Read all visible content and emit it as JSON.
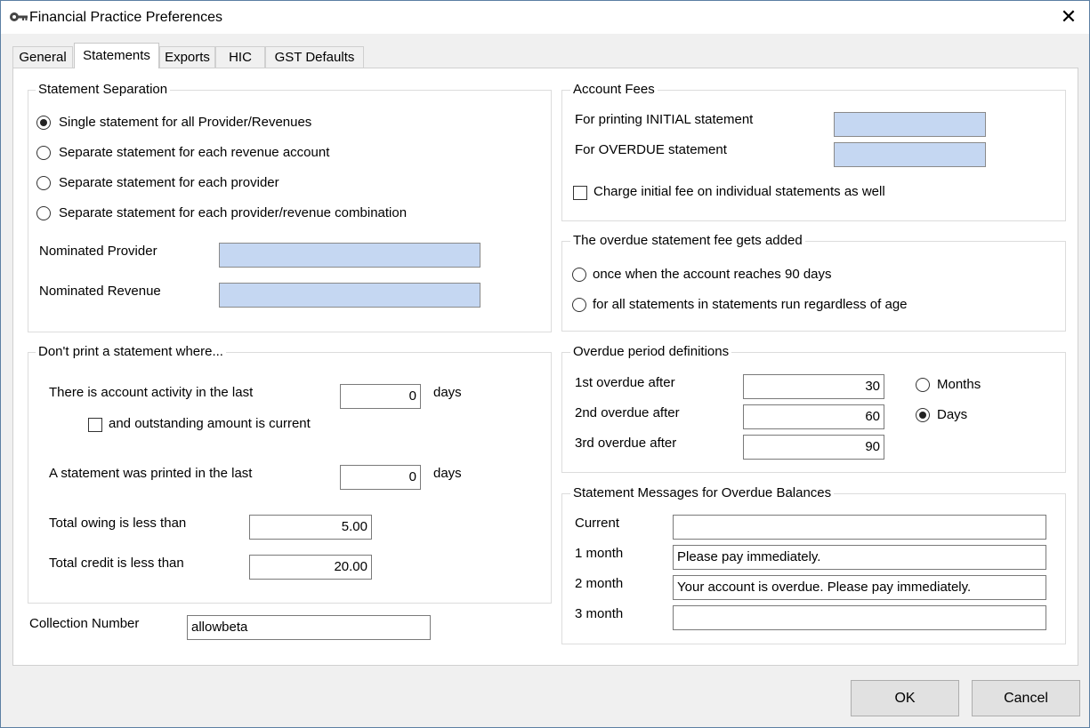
{
  "window": {
    "title": "Financial Practice Preferences",
    "close_glyph": "✕",
    "app_icon": "key-icon"
  },
  "tabs": [
    {
      "label": "General",
      "active": false
    },
    {
      "label": "Statements",
      "active": true
    },
    {
      "label": "Exports",
      "active": false
    },
    {
      "label": "HIC",
      "active": false
    },
    {
      "label": "GST Defaults",
      "active": false
    }
  ],
  "statement_separation": {
    "legend": "Statement Separation",
    "options": [
      {
        "label": "Single statement for all Provider/Revenues",
        "selected": true
      },
      {
        "label": "Separate statement for each revenue account",
        "selected": false
      },
      {
        "label": "Separate statement for each provider",
        "selected": false
      },
      {
        "label": "Separate statement for each provider/revenue combination",
        "selected": false
      }
    ],
    "nominated_provider_label": "Nominated Provider",
    "nominated_provider_value": "",
    "nominated_revenue_label": "Nominated Revenue",
    "nominated_revenue_value": ""
  },
  "dont_print": {
    "legend": "Don't print a statement where...",
    "activity_label": "There is account activity in the last",
    "activity_value": "0",
    "activity_unit": "days",
    "outstanding_label": "and outstanding amount is current",
    "outstanding_checked": false,
    "printed_label": "A statement was printed in the last",
    "printed_value": "0",
    "printed_unit": "days",
    "owing_label": "Total owing is less than",
    "owing_value": "5.00",
    "credit_label": "Total credit is less than",
    "credit_value": "20.00"
  },
  "collection": {
    "label": "Collection Number",
    "value": "allowbeta"
  },
  "account_fees": {
    "legend": "Account Fees",
    "initial_label": "For printing INITIAL statement",
    "initial_value": "",
    "overdue_label": "For OVERDUE statement",
    "overdue_value": "",
    "charge_label": "Charge initial fee on individual statements as well",
    "charge_checked": false
  },
  "overdue_fee": {
    "legend": "The overdue statement fee gets added",
    "options": [
      {
        "label": "once when the account reaches 90 days",
        "selected": false
      },
      {
        "label": "for all statements in statements run regardless of age",
        "selected": false
      }
    ]
  },
  "overdue_period": {
    "legend": "Overdue period definitions",
    "rows": [
      {
        "label": "1st overdue after",
        "value": "30"
      },
      {
        "label": "2nd overdue after",
        "value": "60"
      },
      {
        "label": "3rd overdue after",
        "value": "90"
      }
    ],
    "units": [
      {
        "label": "Months",
        "selected": false
      },
      {
        "label": "Days",
        "selected": true
      }
    ]
  },
  "messages": {
    "legend": "Statement Messages for Overdue Balances",
    "rows": [
      {
        "label": "Current",
        "value": ""
      },
      {
        "label": "1 month",
        "value": "Please pay immediately."
      },
      {
        "label": "2 month",
        "value": "Your account is overdue. Please pay immediately."
      },
      {
        "label": "3 month",
        "value": ""
      }
    ]
  },
  "buttons": {
    "ok": "OK",
    "cancel": "Cancel"
  }
}
